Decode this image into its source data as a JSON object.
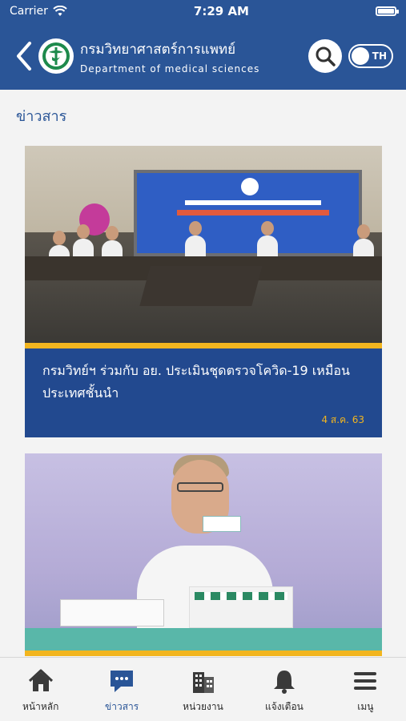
{
  "status": {
    "carrier": "Carrier",
    "time": "7:29 AM"
  },
  "header": {
    "title_th": "กรมวิทยาศาสตร์การแพทย์",
    "title_en": "Department of medical sciences",
    "lang_label": "TH"
  },
  "section": {
    "title": "ข่าวสาร"
  },
  "news": [
    {
      "title": "กรมวิทย์ฯ ร่วมกับ อย. ประเมินชุดตรวจโควิด-19 เหมือนประเทศชั้นนำ",
      "date": "4 ส.ค. 63"
    },
    {
      "title": "",
      "date": ""
    }
  ],
  "tabs": [
    {
      "label": "หน้าหลัก",
      "icon": "home-icon"
    },
    {
      "label": "ข่าวสาร",
      "icon": "chat-icon"
    },
    {
      "label": "หน่วยงาน",
      "icon": "building-icon"
    },
    {
      "label": "แจ้งเตือน",
      "icon": "bell-icon"
    },
    {
      "label": "เมนู",
      "icon": "menu-icon"
    }
  ],
  "colors": {
    "primary": "#2a5597",
    "accent": "#f2b51f",
    "background": "#f3f3f3"
  }
}
